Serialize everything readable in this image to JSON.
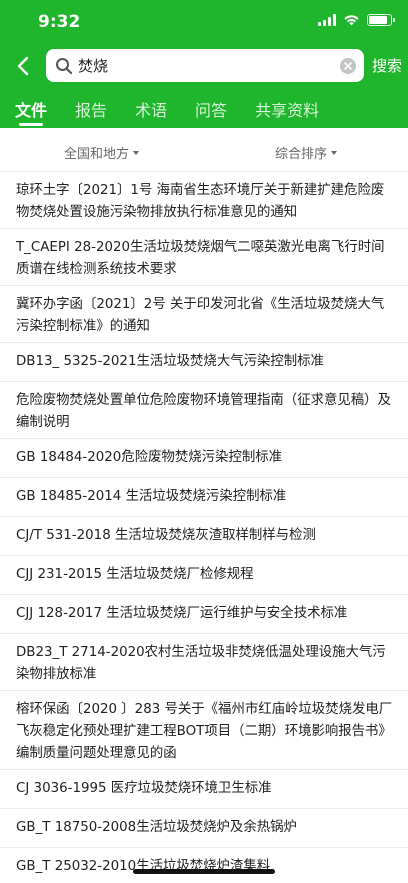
{
  "status_bar": {
    "time": "9:32"
  },
  "search": {
    "query": "焚烧",
    "submit_label": "搜索"
  },
  "tabs": [
    {
      "label": "文件",
      "active": true
    },
    {
      "label": "报告",
      "active": false
    },
    {
      "label": "术语",
      "active": false
    },
    {
      "label": "问答",
      "active": false
    },
    {
      "label": "共享资料",
      "active": false
    }
  ],
  "filters": {
    "region": "全国和地方",
    "sort": "综合排序"
  },
  "results": [
    "琼环土字〔2021〕1号 海南省生态环境厅关于新建扩建危险废物焚烧处置设施污染物排放执行标准意见的通知",
    "T_CAEPI 28-2020生活垃圾焚烧烟气二噁英激光电离飞行时间质谱在线检测系统技术要求",
    "冀环办字函〔2021〕2号 关于印发河北省《生活垃圾焚烧大气污染控制标准》的通知",
    "DB13_ 5325-2021生活垃圾焚烧大气污染控制标准",
    "危险废物焚烧处置单位危险废物环境管理指南（征求意见稿）及编制说明",
    "GB 18484-2020危险废物焚烧污染控制标准",
    "GB 18485-2014 生活垃圾焚烧污染控制标准",
    "CJ/T 531-2018 生活垃圾焚烧灰渣取样制样与检测",
    "CJJ 231-2015 生活垃圾焚烧厂检修规程",
    "CJJ 128-2017 生活垃圾焚烧厂运行维护与安全技术标准",
    "DB23_T 2714-2020农村生活垃圾非焚烧低温处理设施大气污染物排放标准",
    "榕环保函〔2020 〕283 号关于《福州市红庙岭垃圾焚烧发电厂飞灰稳定化预处理扩建工程BOT项目（二期）环境影响报告书》编制质量问题处理意见的函",
    "CJ 3036-1995 医疗垃圾焚烧环境卫生标准",
    "GB_T 18750-2008生活垃圾焚烧炉及余热锅炉",
    "GB_T 25032-2010生活垃圾焚烧炉渣集料"
  ],
  "colors": {
    "brand_green": "#1fb52c"
  },
  "icons": [
    "back-icon",
    "search-icon",
    "clear-icon",
    "wifi-icon",
    "signal-icon",
    "battery-icon",
    "caret-down-icon"
  ]
}
